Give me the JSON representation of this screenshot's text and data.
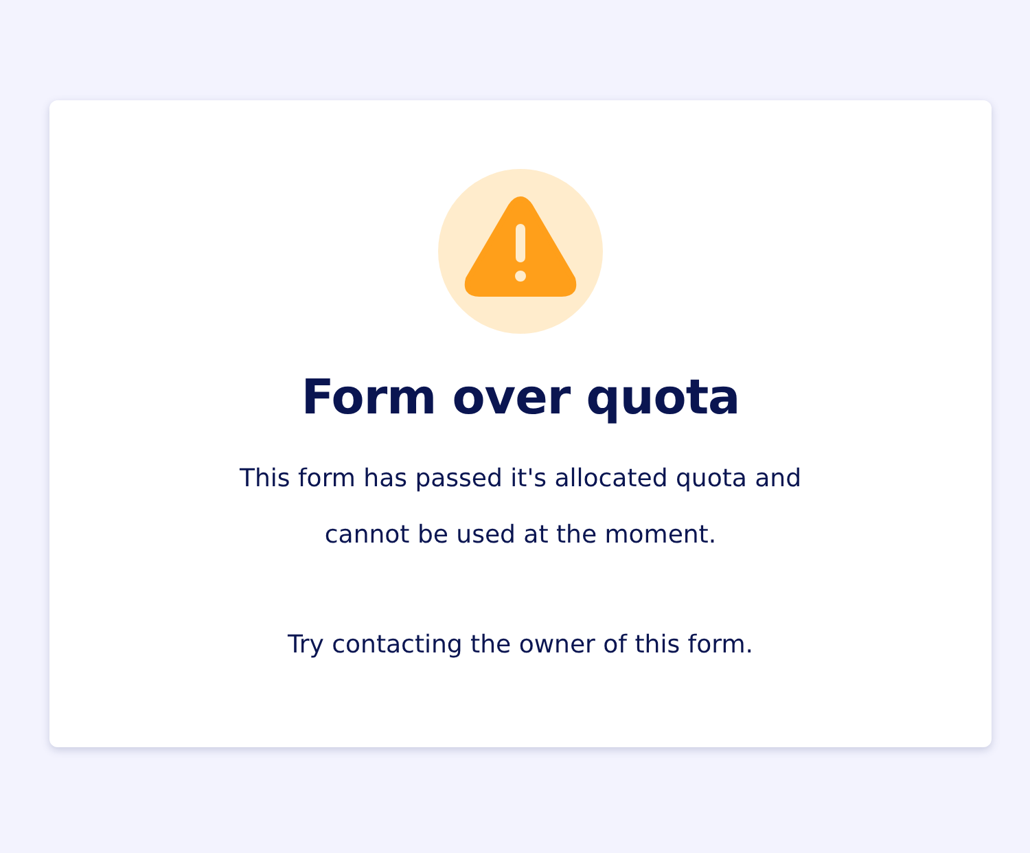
{
  "card": {
    "title": "Form over quota",
    "message": "This form has passed it's allocated quota and cannot be used at the moment.",
    "hint": "Try contacting the owner of this form."
  }
}
